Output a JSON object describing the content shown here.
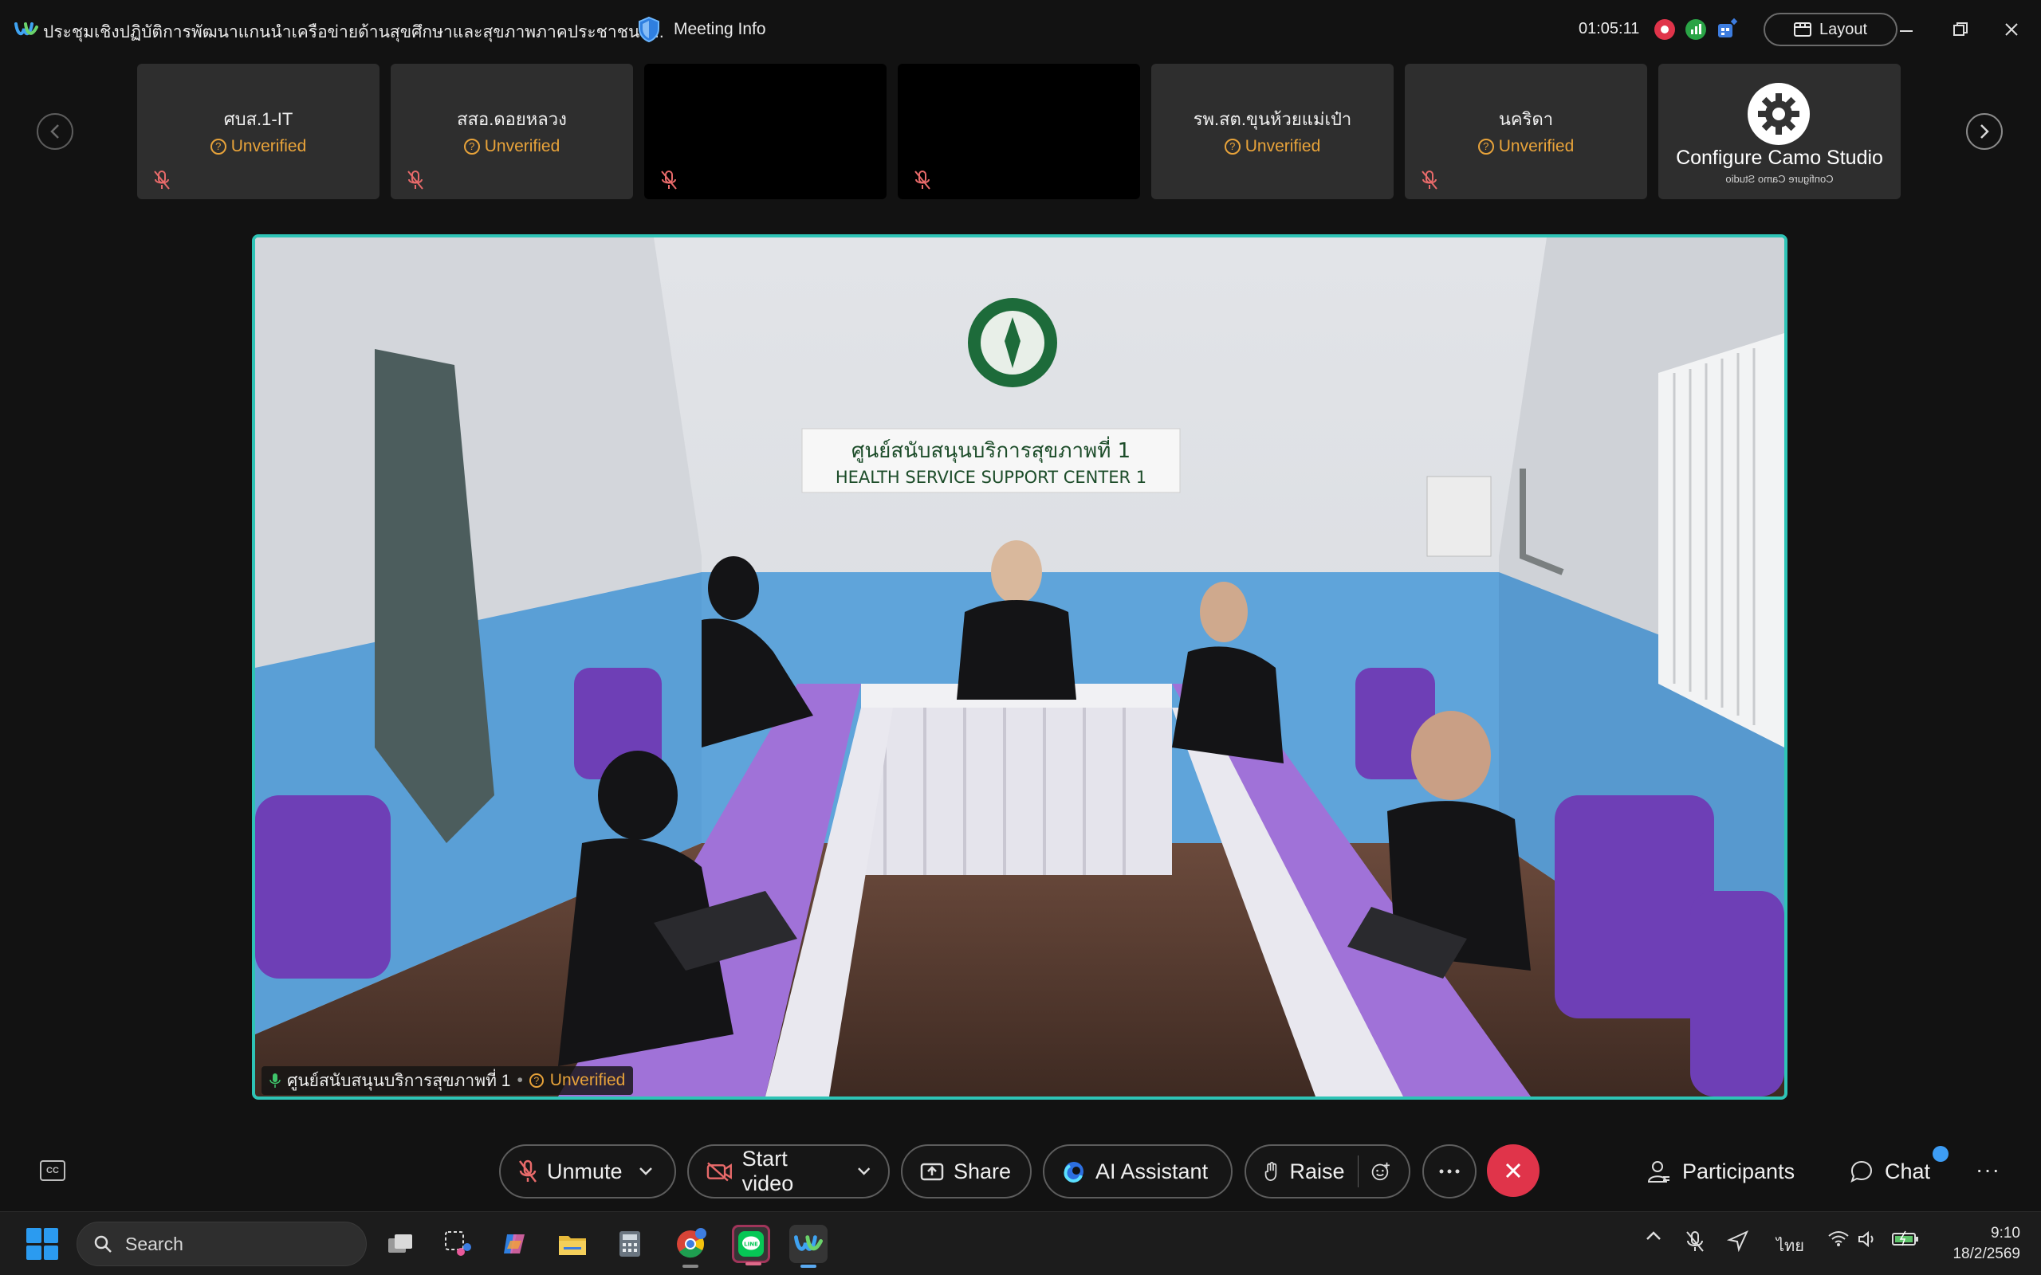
{
  "titlebar": {
    "meeting_title": "ประชุมเชิงปฏิบัติการพัฒนาแกนนำเครือข่ายด้านสุขศึกษาและสุขภาพภาคประชาชน (...",
    "meeting_info_label": "Meeting Info",
    "elapsed_time": "01:05:11",
    "layout_label": "Layout"
  },
  "thumbnails": [
    {
      "name": "ศบส.1-IT",
      "status": "Unverified",
      "video": false
    },
    {
      "name": "สสอ.ดอยหลวง",
      "status": "Unverified",
      "video": false
    },
    {
      "name": "",
      "status": "",
      "video": true
    },
    {
      "name": "",
      "status": "",
      "video": true
    },
    {
      "name": "รพ.สต.ขุนห้วยแม่เป๋า",
      "status": "Unverified",
      "video": false
    },
    {
      "name": "นคริดา",
      "status": "Unverified",
      "video": false
    }
  ],
  "camo_tile": {
    "title": "Configure Camo Studio",
    "subtitle": "Configure Camo Studio"
  },
  "main_video": {
    "speaker_name": "ศูนย์สนับสนุนบริการสุขภาพที่ 1",
    "speaker_status": "Unverified",
    "room_sign_thai": "ศูนย์สนับสนุนบริการสุขภาพที่ 1",
    "room_sign_english": "HEALTH SERVICE SUPPORT CENTER 1"
  },
  "controls": {
    "unmute_label": "Unmute",
    "start_video_label": "Start video",
    "share_label": "Share",
    "ai_assistant_label": "AI Assistant",
    "raise_label": "Raise",
    "participants_label": "Participants",
    "chat_label": "Chat",
    "cc_label": "CC"
  },
  "taskbar": {
    "search_label": "Search",
    "language": "ไทย",
    "time": "9:10",
    "date": "18/2/2569"
  },
  "colors": {
    "accent_teal": "#2ec4b6",
    "unverified_orange": "#e8a33a",
    "end_call_red": "#e0344a",
    "chat_dot_blue": "#3d9df5"
  }
}
